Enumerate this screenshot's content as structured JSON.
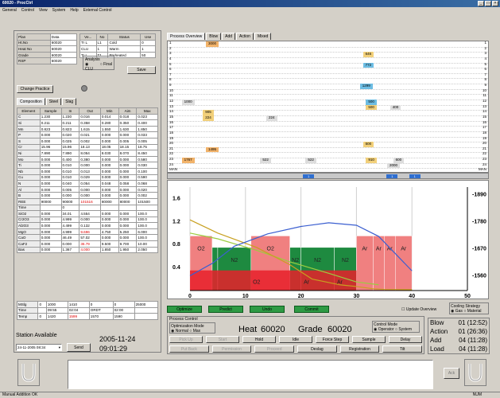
{
  "window": {
    "title": "60020 - ProcCtrl",
    "controls": [
      "_",
      "□",
      "×"
    ]
  },
  "menu": [
    "General",
    "Control",
    "View",
    "System",
    "Help",
    "External Control"
  ],
  "heat_info": {
    "rows": [
      {
        "label": "Plan",
        "value": "Data"
      },
      {
        "label": "Ht.No",
        "value": "60020"
      },
      {
        "label": "Heat No",
        "value": "60020"
      },
      {
        "label": "Grade",
        "value": "60020"
      },
      {
        "label": "RSP",
        "value": "60020"
      }
    ]
  },
  "vessel_table": {
    "headers": [
      "Ve...",
      "No",
      "Status",
      "Use"
    ],
    "rows": [
      [
        "Tr L",
        "L1",
        "Cold",
        "0"
      ],
      [
        "CLU",
        "1",
        "Warm",
        "1"
      ],
      [
        "Tr L",
        "T1",
        "Preheated",
        "50"
      ]
    ]
  },
  "analysis": {
    "label": "Analysis",
    "options": [
      "CLU",
      "Final"
    ],
    "save": "Save"
  },
  "change_practice": "Change Practice",
  "left_tabs": [
    "Composition",
    "Steel",
    "Slag"
  ],
  "composition": {
    "headers": [
      "Element",
      "Sample",
      "In",
      "Out",
      "Min",
      "Aim",
      "Max"
    ],
    "rows": [
      [
        "C",
        "1.230",
        "1.230",
        "0.016",
        "0.014",
        "0.018",
        "0.023"
      ],
      [
        "Si",
        "0.211",
        "0.211",
        "0.358",
        "0.280",
        "0.350",
        "0.400"
      ],
      [
        "Mn",
        "0.823",
        "0.823",
        "1.615",
        "1.550",
        "1.630",
        "1.850"
      ],
      [
        "P",
        "0.000",
        "0.020",
        "0.021",
        "0.000",
        "0.000",
        "0.033"
      ],
      [
        "S",
        "0.000",
        "0.025",
        "0.002",
        "0.000",
        "0.005",
        "0.005"
      ],
      [
        "Cr",
        "15.96",
        "15.96",
        "18.13",
        "18.05",
        "18.15",
        "18.75"
      ],
      [
        "Ni",
        "7.890",
        "7.890",
        "8.054",
        "8.030",
        "8.070",
        "8.450"
      ],
      [
        "Mo",
        "0.000",
        "0.400",
        "0.380",
        "0.000",
        "0.000",
        "0.580"
      ],
      [
        "Ti",
        "0.000",
        "0.010",
        "0.000",
        "0.000",
        "0.000",
        "0.030"
      ],
      [
        "Nb",
        "0.000",
        "0.010",
        "0.013",
        "0.000",
        "0.000",
        "0.100"
      ],
      [
        "Cu",
        "0.000",
        "0.010",
        "0.029",
        "0.000",
        "0.000",
        "0.590"
      ],
      [
        "N",
        "0.000",
        "0.040",
        "0.054",
        "0.048",
        "0.058",
        "0.068"
      ],
      [
        "Al",
        "0.000",
        "0.005",
        "0.000",
        "0.000",
        "0.000",
        "0.020"
      ],
      [
        "B",
        "0.000",
        "0.000",
        "0.000",
        "0.000",
        "0.000",
        "0.002"
      ],
      [
        "REE",
        "90000",
        "90000",
        "101516",
        "80000",
        "80000",
        "101500"
      ],
      [
        "Time",
        "",
        "0",
        "",
        "",
        "",
        ""
      ],
      [
        "SiO2",
        "0.000",
        "34.01",
        "4.554",
        "0.000",
        "0.000",
        "100.0"
      ],
      [
        "Cr2O3",
        "0.000",
        "4.999",
        "0.000",
        "0.000",
        "0.000",
        "100.0"
      ],
      [
        "Al2O3",
        "0.000",
        "4.499",
        "0.132",
        "0.000",
        "0.000",
        "100.0"
      ],
      [
        "MgO",
        "0.000",
        "4.999",
        "9.696",
        "4.750",
        "5.250",
        "6.000"
      ],
      [
        "CaO",
        "0.000",
        "46.49",
        "57.02",
        "0.000",
        "0.000",
        "100.0"
      ],
      [
        "CaF2",
        "0.000",
        "0.000",
        "36.79",
        "9.500",
        "9.700",
        "10.00"
      ],
      [
        "Bas",
        "0.000",
        "1.367",
        "4.000",
        "1.850",
        "1.950",
        "2.050"
      ]
    ],
    "red_cells": [
      [
        14,
        3
      ],
      [
        19,
        3
      ],
      [
        21,
        3
      ],
      [
        22,
        3
      ]
    ]
  },
  "weights": {
    "rows": [
      [
        "MSlg",
        "0",
        "1000",
        "1410",
        "0",
        "0",
        "25000"
      ],
      [
        "Time",
        "",
        "09:55",
        "02:04",
        "ORDT",
        "02:00",
        ""
      ],
      [
        "Temp",
        "0",
        "1420",
        "1599",
        "1570",
        "1590",
        ""
      ]
    ],
    "red_cells": [
      [
        2,
        3
      ]
    ]
  },
  "station": {
    "label": "Station Available",
    "date": "24-11-2005 08:34",
    "send": "Send",
    "clock_date": "2005-11-24",
    "clock_time": "09:01:29"
  },
  "right_tabs": [
    "Process Overview",
    "Blow",
    "Add",
    "Action",
    "Mixed"
  ],
  "overview": {
    "row_labels": [
      "1",
      "2",
      "3",
      "4",
      "5",
      "6",
      "7",
      "8",
      "9",
      "10",
      "11",
      "12",
      "13",
      "14",
      "15",
      "16",
      "17",
      "18",
      "19",
      "20",
      "21",
      "22",
      "23",
      "24",
      "MAN"
    ],
    "markers": [
      {
        "row": 1,
        "pos": 0.1,
        "text": "3000",
        "color": "#f2b36a"
      },
      {
        "row": 3,
        "pos": 0.62,
        "text": "646",
        "color": "#f2d07a"
      },
      {
        "row": 5,
        "pos": 0.62,
        "text": "772",
        "color": "#6dbde3"
      },
      {
        "row": 9,
        "pos": 0.61,
        "text": "1299",
        "color": "#6dbde3"
      },
      {
        "row": 12,
        "pos": 0.02,
        "text": "1000",
        "color": "#dddddd"
      },
      {
        "row": 12,
        "pos": 0.63,
        "text": "500",
        "color": "#6dbde3"
      },
      {
        "row": 13,
        "pos": 0.63,
        "text": "500",
        "color": "#f2d07a"
      },
      {
        "row": 13,
        "pos": 0.71,
        "text": "400",
        "color": "#dddddd"
      },
      {
        "row": 14,
        "pos": 0.09,
        "text": "905",
        "color": "#f2d07a"
      },
      {
        "row": 15,
        "pos": 0.09,
        "text": "224",
        "color": "#f2d07a"
      },
      {
        "row": 15,
        "pos": 0.3,
        "text": "224",
        "color": "#dddddd"
      },
      {
        "row": 20,
        "pos": 0.62,
        "text": "500",
        "color": "#f2d07a"
      },
      {
        "row": 21,
        "pos": 0.1,
        "text": "1495",
        "color": "#f2b36a"
      },
      {
        "row": 23,
        "pos": 0.02,
        "text": "1767",
        "color": "#f2b36a"
      },
      {
        "row": 23,
        "pos": 0.28,
        "text": "522",
        "color": "#dddddd"
      },
      {
        "row": 23,
        "pos": 0.43,
        "text": "522",
        "color": "#dddddd"
      },
      {
        "row": 23,
        "pos": 0.63,
        "text": "910",
        "color": "#f2d07a"
      },
      {
        "row": 23,
        "pos": 0.72,
        "text": "600",
        "color": "#dddddd"
      },
      {
        "row": 24,
        "pos": 0.7,
        "text": "2000",
        "color": "#dddddd"
      }
    ],
    "blue_markers": [
      {
        "pos": 0.42,
        "text": "1"
      },
      {
        "pos": 0.68,
        "text": "1"
      },
      {
        "pos": 0.75,
        "text": "1"
      }
    ]
  },
  "chart_data": {
    "type": "area",
    "x_ticks": [
      "0",
      "10",
      "20",
      "30",
      "40",
      "50"
    ],
    "xlim": [
      0,
      50
    ],
    "left_ticks": [
      "0.4",
      "0.8",
      "1.2",
      "1.6"
    ],
    "ylim_left": [
      0,
      1.8
    ],
    "right_ticks": [
      "1560",
      "1670",
      "1780",
      "1890"
    ],
    "ylim_right": [
      1500,
      1920
    ],
    "segments": [
      {
        "x0": 0,
        "x1": 4,
        "label": "O2",
        "color": "#f08080"
      },
      {
        "x0": 4,
        "x1": 5,
        "label": "",
        "color": "#1e8a40"
      },
      {
        "x0": 5,
        "x1": 11,
        "label": "N2",
        "color": "#1e8a40"
      },
      {
        "x0": 11,
        "x1": 18,
        "label": "O2",
        "color": "#f08080"
      },
      {
        "x0": 18,
        "x1": 20,
        "label": "N2",
        "color": "#1e8a40"
      },
      {
        "x0": 20,
        "x1": 26,
        "label": "N2",
        "color": "#1e8a40"
      },
      {
        "x0": 26,
        "x1": 30,
        "label": "N2",
        "color": "#1e8a40"
      },
      {
        "x0": 30,
        "x1": 33,
        "label": "Ar",
        "color": "#f08080"
      },
      {
        "x0": 33,
        "x1": 35,
        "label": "Ar",
        "color": "#f08080"
      },
      {
        "x0": 35,
        "x1": 37,
        "label": "Ar",
        "color": "#f08080"
      },
      {
        "x0": 37,
        "x1": 40,
        "label": "Ar",
        "color": "#f08080"
      }
    ],
    "bottom_labels": [
      {
        "x": 12,
        "text": "O2"
      },
      {
        "x": 21,
        "text": "Ar"
      },
      {
        "x": 27,
        "text": "Ar"
      }
    ],
    "temp_line": {
      "x": [
        0,
        4,
        8,
        14,
        20,
        25,
        30,
        34,
        37,
        40
      ],
      "y": [
        1560,
        1610,
        1680,
        1730,
        1760,
        1775,
        1765,
        1720,
        1650,
        1580
      ]
    },
    "carbon_line": {
      "x": [
        0,
        5,
        12,
        18,
        22,
        27,
        30,
        33,
        35,
        40
      ],
      "y": [
        1.23,
        1.0,
        0.75,
        0.45,
        0.2,
        0.1,
        0.07,
        0.03,
        0.02,
        0.016
      ]
    },
    "green_line": {
      "x": [
        0,
        5,
        12,
        18,
        25,
        30,
        34
      ],
      "y": [
        1.0,
        0.9,
        0.7,
        0.5,
        0.3,
        0.15,
        0.1
      ]
    }
  },
  "controls": {
    "green_buttons": [
      "Optimize",
      "Predict",
      "Undo",
      "Commit"
    ],
    "update_overview": "Update Overview",
    "cooling": {
      "label": "Cooling Strategy",
      "options": [
        "Gas",
        "Material"
      ]
    },
    "process_control": "Process Control",
    "opt_mode": {
      "label": "Optimization Mode",
      "options": [
        "Normal",
        "Max"
      ]
    },
    "heat_label": "Heat",
    "heat_value": "60020",
    "grade_label": "Grade",
    "grade_value": "60020",
    "control_mode": {
      "label": "Control Mode",
      "options": [
        "Operator",
        "System"
      ]
    },
    "row1": [
      "Pick Up",
      "Start",
      "Hold",
      "Idle",
      "Force Step",
      "Sample",
      "Delay"
    ],
    "row2": [
      "Put Back",
      "Permission",
      "Proceed",
      "Deslag",
      "Registration",
      "Tilt"
    ]
  },
  "stats": [
    {
      "label": "Blow",
      "value": "01 (12:52)"
    },
    {
      "label": "Action",
      "value": "01 (26:36)"
    },
    {
      "label": "Add",
      "value": "04 (11:28)"
    },
    {
      "label": "Load",
      "value": "04 (11:28)"
    }
  ],
  "bottom": {
    "ack": "Ack",
    "status": "Manual Addition OK",
    "status_right": "NUM"
  }
}
